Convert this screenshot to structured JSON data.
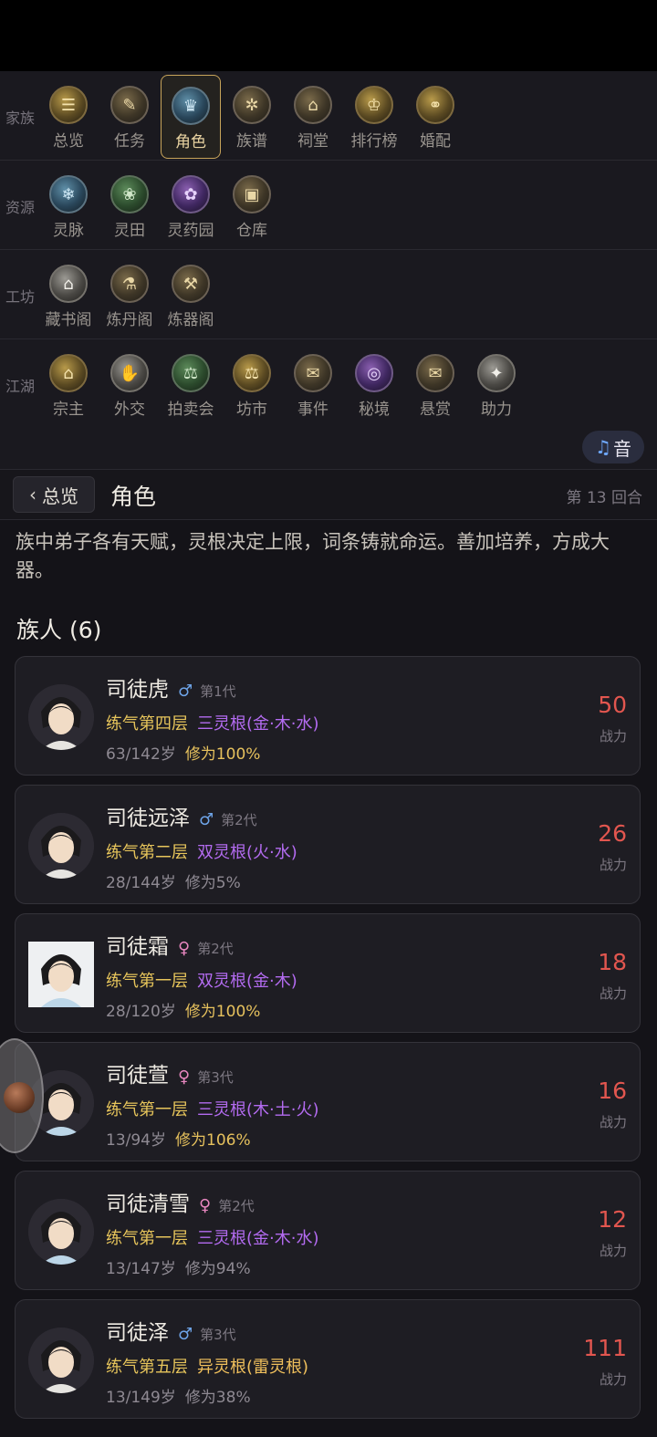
{
  "nav": {
    "rows": [
      {
        "label": "家族",
        "items": [
          {
            "label": "总览",
            "icon": "overview-icon",
            "glyph": "☰"
          },
          {
            "label": "任务",
            "icon": "task-icon",
            "glyph": "✎"
          },
          {
            "label": "角色",
            "icon": "character-icon",
            "glyph": "♛",
            "active": true
          },
          {
            "label": "族谱",
            "icon": "genealogy-icon",
            "glyph": "✲"
          },
          {
            "label": "祠堂",
            "icon": "shrine-icon",
            "glyph": "⌂"
          },
          {
            "label": "排行榜",
            "icon": "ranking-icon",
            "glyph": "♔"
          },
          {
            "label": "婚配",
            "icon": "marriage-icon",
            "glyph": "⚭"
          }
        ]
      },
      {
        "label": "资源",
        "items": [
          {
            "label": "灵脉",
            "icon": "spirit-vein-icon",
            "glyph": "❄"
          },
          {
            "label": "灵田",
            "icon": "spirit-field-icon",
            "glyph": "❀"
          },
          {
            "label": "灵药园",
            "icon": "herb-garden-icon",
            "glyph": "✿"
          },
          {
            "label": "仓库",
            "icon": "warehouse-icon",
            "glyph": "▣"
          }
        ]
      },
      {
        "label": "工坊",
        "items": [
          {
            "label": "藏书阁",
            "icon": "library-icon",
            "glyph": "⌂"
          },
          {
            "label": "炼丹阁",
            "icon": "alchemy-icon",
            "glyph": "⚗"
          },
          {
            "label": "炼器阁",
            "icon": "forge-icon",
            "glyph": "⚒"
          }
        ]
      },
      {
        "label": "江湖",
        "items": [
          {
            "label": "宗主",
            "icon": "sect-master-icon",
            "glyph": "⌂"
          },
          {
            "label": "外交",
            "icon": "diplomacy-icon",
            "glyph": "✋"
          },
          {
            "label": "拍卖会",
            "icon": "auction-icon",
            "glyph": "⚖"
          },
          {
            "label": "坊市",
            "icon": "market-icon",
            "glyph": "⚖"
          },
          {
            "label": "事件",
            "icon": "event-icon",
            "glyph": "✉"
          },
          {
            "label": "秘境",
            "icon": "secret-realm-icon",
            "glyph": "◎"
          },
          {
            "label": "悬赏",
            "icon": "bounty-icon",
            "glyph": "✉"
          },
          {
            "label": "助力",
            "icon": "assist-icon",
            "glyph": "✦"
          }
        ]
      }
    ],
    "sound": {
      "label": "音",
      "icon": "music-note-icon",
      "glyph": "♫"
    }
  },
  "header": {
    "back_label": "总览",
    "back_glyph": "‹",
    "title": "角色",
    "round": "第 13 回合"
  },
  "intro": "族中弟子各有天赋，灵根决定上限，词条铸就命运。善加培养，方成大器。",
  "section_title": "族人 (6)",
  "members": [
    {
      "name": "司徒虎",
      "gender_symbol": "♂",
      "gender": "m",
      "generation": "第1代",
      "realm": "练气第四层",
      "root": "三灵根(金·木·水)",
      "root_type": "normal",
      "age": "63/142岁",
      "cultivation": "修为100%",
      "cult_high": true,
      "power": "50",
      "power_label": "战力"
    },
    {
      "name": "司徒远泽",
      "gender_symbol": "♂",
      "gender": "m",
      "generation": "第2代",
      "realm": "练气第二层",
      "root": "双灵根(火·水)",
      "root_type": "normal",
      "age": "28/144岁",
      "cultivation": "修为5%",
      "cult_high": false,
      "power": "26",
      "power_label": "战力"
    },
    {
      "name": "司徒霜",
      "gender_symbol": "♀",
      "gender": "f",
      "generation": "第2代",
      "realm": "练气第一层",
      "root": "双灵根(金·木)",
      "root_type": "normal",
      "age": "28/120岁",
      "cultivation": "修为100%",
      "cult_high": true,
      "power": "18",
      "power_label": "战力"
    },
    {
      "name": "司徒萱",
      "gender_symbol": "♀",
      "gender": "f",
      "generation": "第3代",
      "realm": "练气第一层",
      "root": "三灵根(木·土·火)",
      "root_type": "normal",
      "age": "13/94岁",
      "cultivation": "修为106%",
      "cult_high": true,
      "power": "16",
      "power_label": "战力"
    },
    {
      "name": "司徒清雪",
      "gender_symbol": "♀",
      "gender": "f",
      "generation": "第2代",
      "realm": "练气第一层",
      "root": "三灵根(金·木·水)",
      "root_type": "normal",
      "age": "13/147岁",
      "cultivation": "修为94%",
      "cult_high": false,
      "power": "12",
      "power_label": "战力"
    },
    {
      "name": "司徒泽",
      "gender_symbol": "♂",
      "gender": "m",
      "generation": "第3代",
      "realm": "练气第五层",
      "root": "异灵根(雷灵根)",
      "root_type": "exotic",
      "age": "13/149岁",
      "cultivation": "修为38%",
      "cult_high": false,
      "power": "111",
      "power_label": "战力"
    }
  ]
}
